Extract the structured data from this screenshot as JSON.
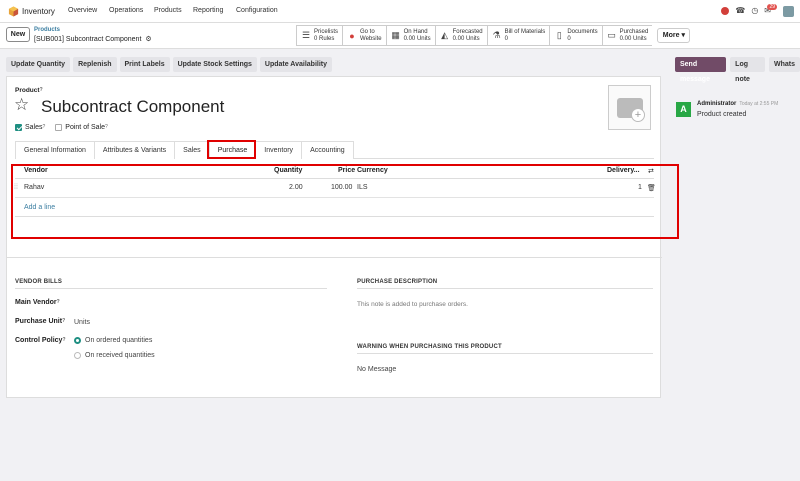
{
  "topnav": {
    "app_name": "Inventory",
    "menu": [
      "Overview",
      "Operations",
      "Products",
      "Reporting",
      "Configuration"
    ],
    "notification_count": "29"
  },
  "breadcrumb": {
    "new_label": "New",
    "parent": "Products",
    "current": "[SUB001] Subcontract Component"
  },
  "smart_buttons": [
    {
      "icon": "list-icon",
      "line1": "Pricelists",
      "line2": "0 Rules"
    },
    {
      "icon": "globe-icon",
      "line1": "Go to",
      "line2": "Website"
    },
    {
      "icon": "cubes-icon",
      "line1": "On Hand",
      "line2": "0.00 Units"
    },
    {
      "icon": "area-chart-icon",
      "line1": "Forecasted",
      "line2": "0.00 Units"
    },
    {
      "icon": "flask-icon",
      "line1": "Bill of Materials",
      "line2": "0"
    },
    {
      "icon": "file-icon",
      "line1": "Documents",
      "line2": "0"
    },
    {
      "icon": "credit-card-icon",
      "line1": "Purchased",
      "line2": "0.00 Units"
    }
  ],
  "more_label": "More",
  "actions": [
    "Update Quantity",
    "Replenish",
    "Print Labels",
    "Update Stock Settings",
    "Update Availability"
  ],
  "product": {
    "label": "Product",
    "name": "Subcontract Component",
    "sales_label": "Sales",
    "pos_label": "Point of Sale"
  },
  "tabs": [
    "General Information",
    "Attributes & Variants",
    "Sales",
    "Purchase",
    "Inventory",
    "Accounting"
  ],
  "vendor_table": {
    "headers": {
      "vendor": "Vendor",
      "quantity": "Quantity",
      "price": "Price",
      "currency": "Currency",
      "delivery": "Delivery..."
    },
    "rows": [
      {
        "vendor": "Rahav",
        "quantity": "2.00",
        "price": "100.00",
        "currency": "ILS",
        "delivery": "1"
      }
    ],
    "add_line": "Add a line"
  },
  "vendor_bills": {
    "title": "VENDOR BILLS",
    "main_vendor_label": "Main Vendor",
    "purchase_unit_label": "Purchase Unit",
    "purchase_unit_value": "Units",
    "control_policy_label": "Control Policy",
    "policy_options": [
      "On ordered quantities",
      "On received quantities"
    ]
  },
  "purchase_description": {
    "title": "PURCHASE DESCRIPTION",
    "placeholder": "This note is added to purchase orders."
  },
  "warning": {
    "title": "WARNING WHEN PURCHASING THIS PRODUCT",
    "value": "No Message"
  },
  "chatter": {
    "buttons": [
      "Send message",
      "Log note",
      "Whats"
    ],
    "message": {
      "avatar_letter": "A",
      "author": "Administrator",
      "time": "Today at 2:55 PM",
      "body": "Product created"
    }
  },
  "colors": {
    "brand": "#714b67",
    "accent": "#1f8f82",
    "highlight": "#e00000",
    "link": "#3b7ea1"
  }
}
